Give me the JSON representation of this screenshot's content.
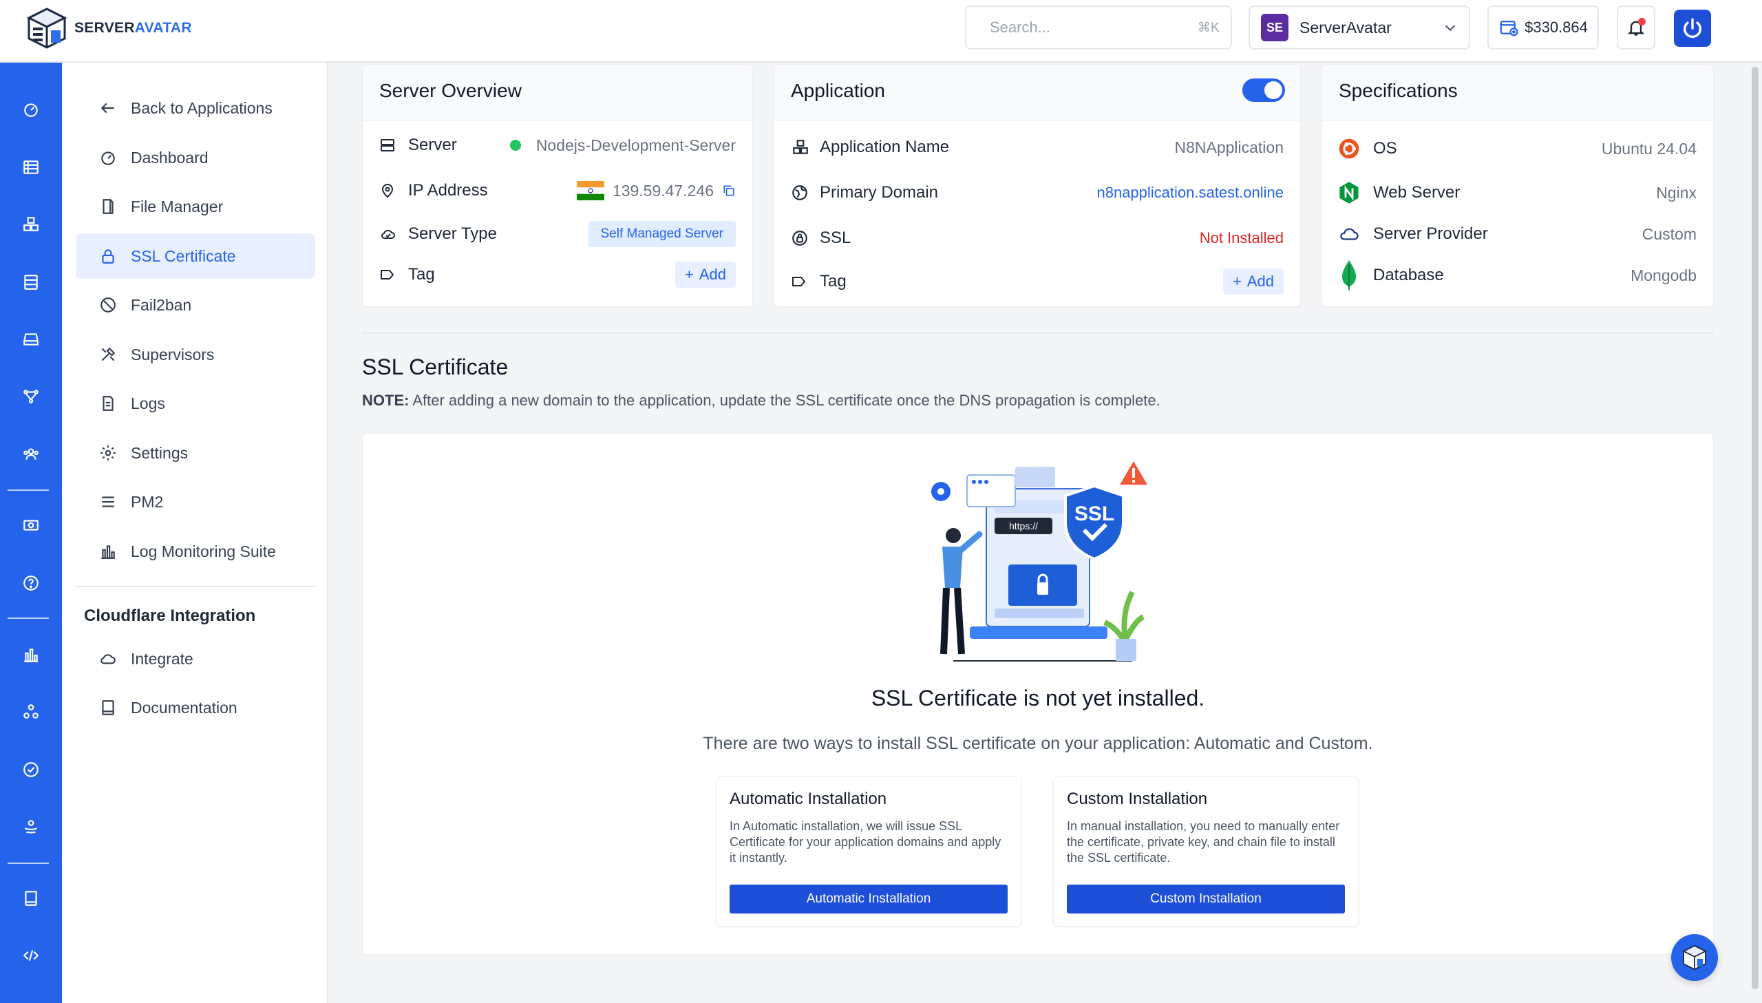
{
  "brand": {
    "name_part1": "SERVER",
    "name_part2": "AVATAR"
  },
  "header": {
    "search_placeholder": "Search...",
    "search_shortcut": "⌘K",
    "org_initials": "SE",
    "org_name": "ServerAvatar",
    "balance": "$330.864"
  },
  "sidebar": {
    "back_label": "Back to Applications",
    "items": [
      {
        "label": "Dashboard",
        "icon": "gauge-icon"
      },
      {
        "label": "File Manager",
        "icon": "file-icon"
      },
      {
        "label": "SSL Certificate",
        "icon": "lock-icon",
        "active": true
      },
      {
        "label": "Fail2ban",
        "icon": "ban-icon"
      },
      {
        "label": "Supervisors",
        "icon": "tools-icon"
      },
      {
        "label": "Logs",
        "icon": "document-icon"
      },
      {
        "label": "Settings",
        "icon": "gear-icon"
      },
      {
        "label": "PM2",
        "icon": "menu-icon"
      },
      {
        "label": "Log Monitoring Suite",
        "icon": "bar-chart-icon"
      }
    ],
    "cloudflare_heading": "Cloudflare Integration",
    "cloudflare_items": [
      {
        "label": "Integrate",
        "icon": "cloud-icon"
      },
      {
        "label": "Documentation",
        "icon": "book-icon"
      }
    ]
  },
  "server_overview": {
    "title": "Server Overview",
    "server_label": "Server",
    "server_value": "Nodejs-Development-Server",
    "ip_label": "IP Address",
    "ip_value": "139.59.47.246",
    "type_label": "Server Type",
    "type_value": "Self Managed Server",
    "tag_label": "Tag",
    "add_label": "Add"
  },
  "application": {
    "title": "Application",
    "name_label": "Application Name",
    "name_value": "N8NApplication",
    "domain_label": "Primary Domain",
    "domain_value": "n8napplication.satest.online",
    "ssl_label": "SSL",
    "ssl_value": "Not Installed",
    "tag_label": "Tag",
    "add_label": "Add",
    "enabled": true
  },
  "specifications": {
    "title": "Specifications",
    "os_label": "OS",
    "os_value": "Ubuntu 24.04",
    "webserver_label": "Web Server",
    "webserver_value": "Nginx",
    "provider_label": "Server Provider",
    "provider_value": "Custom",
    "database_label": "Database",
    "database_value": "Mongodb"
  },
  "ssl": {
    "title": "SSL Certificate",
    "note_prefix": "NOTE:",
    "note_text": " After adding a new domain to the application, update the SSL certificate once the DNS propagation is complete.",
    "illustration_badge": "SSL",
    "illustration_url": "https://",
    "not_installed": "SSL Certificate is not yet installed.",
    "two_ways": "There are two ways to install SSL certificate on your application: Automatic and Custom.",
    "auto": {
      "title": "Automatic Installation",
      "desc": "In Automatic installation, we will issue SSL Certificate for your application domains and apply it instantly.",
      "button": "Automatic Installation"
    },
    "custom": {
      "title": "Custom Installation",
      "desc": "In manual installation, you need to manually enter the certificate, private key, and chain file to install the SSL certificate.",
      "button": "Custom Installation"
    }
  },
  "colors": {
    "primary": "#2563eb",
    "danger": "#dc2626",
    "success": "#22c55e"
  }
}
